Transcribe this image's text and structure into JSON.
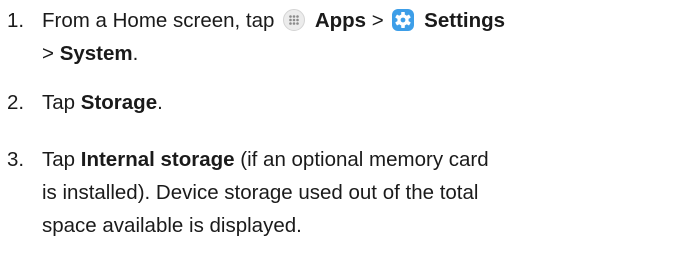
{
  "steps": [
    {
      "number": "1.",
      "parts": {
        "t1": "From a Home screen, tap",
        "apps_label": "Apps",
        "sep1": ">",
        "settings_label": "Settings",
        "sep2": ">",
        "system_label": "System",
        "end": "."
      },
      "icons": [
        "apps-icon",
        "settings-gear-icon"
      ]
    },
    {
      "number": "2.",
      "parts": {
        "t1": "Tap",
        "storage_label": "Storage",
        "end": "."
      }
    },
    {
      "number": "3.",
      "parts": {
        "t1": "Tap",
        "internal_label": "Internal storage",
        "l1_rest": "(if an optional memory card",
        "l2": "is installed). Device storage used out of the total",
        "l3": "space available is displayed."
      }
    }
  ],
  "colors": {
    "text": "#1a1a1a",
    "settings_icon_bg": "#3d9ee8",
    "apps_icon_bg": "#ececec"
  }
}
